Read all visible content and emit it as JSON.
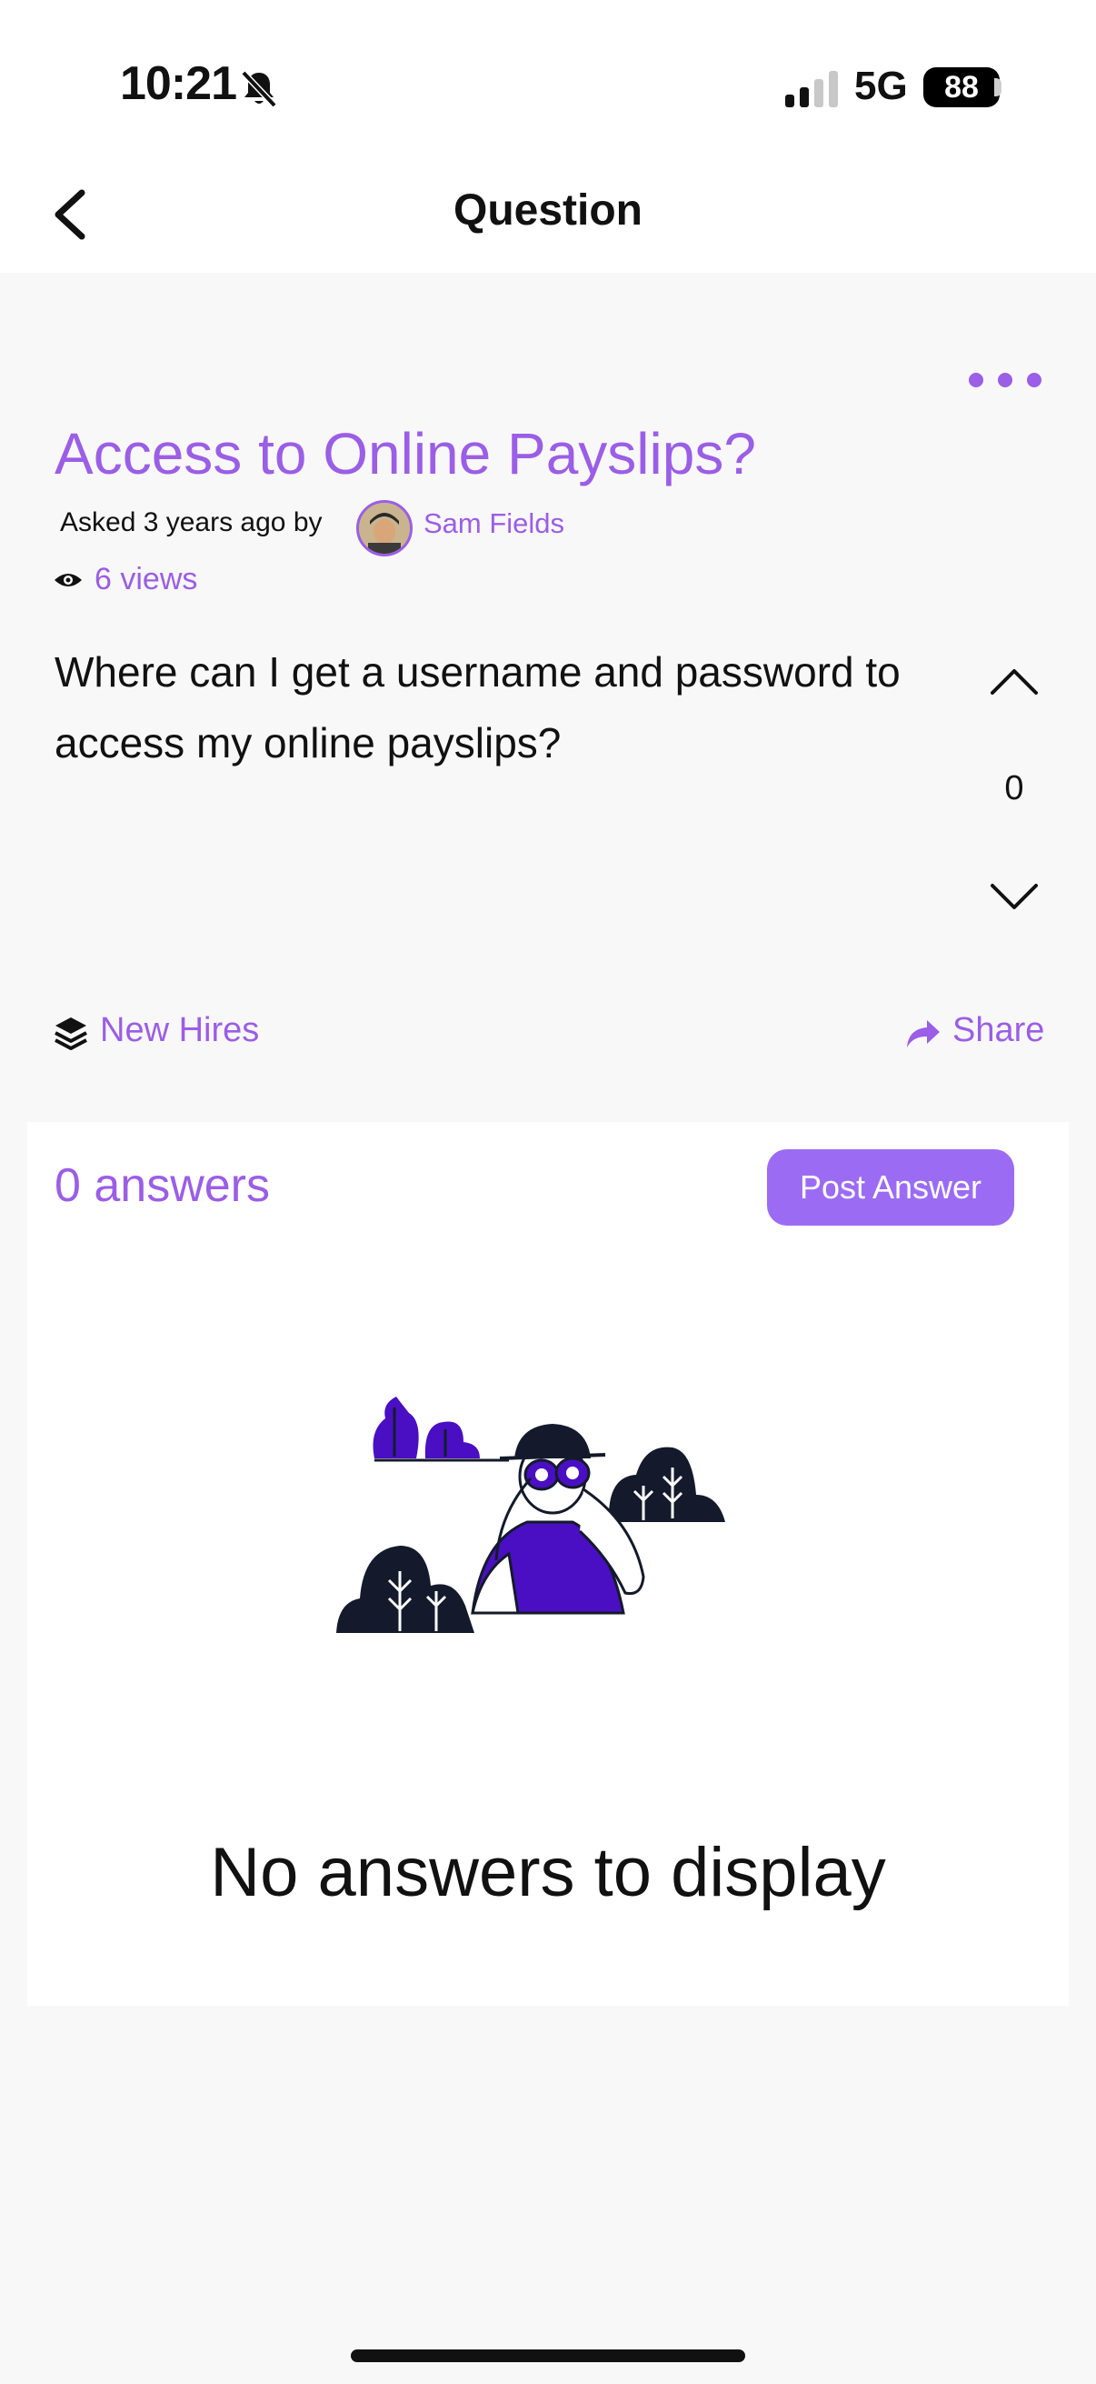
{
  "status_bar": {
    "time": "10:21",
    "network": "5G",
    "battery": "88"
  },
  "nav": {
    "title": "Question"
  },
  "question": {
    "title": "Access to Online Payslips?",
    "asked_text": "Asked 3 years ago by",
    "author": "Sam Fields",
    "views": "6 views",
    "body": "Where can I get a username and password to access my online payslips?",
    "score": "0",
    "tag": "New Hires",
    "share_label": "Share"
  },
  "answers": {
    "count_label": "0 answers",
    "post_button": "Post Answer",
    "empty_message": "No answers to display"
  },
  "colors": {
    "accent": "#9b5ee6",
    "button": "#9b6cf3",
    "illustration_purple": "#4a0fc2",
    "illustration_dark": "#141a2b"
  }
}
